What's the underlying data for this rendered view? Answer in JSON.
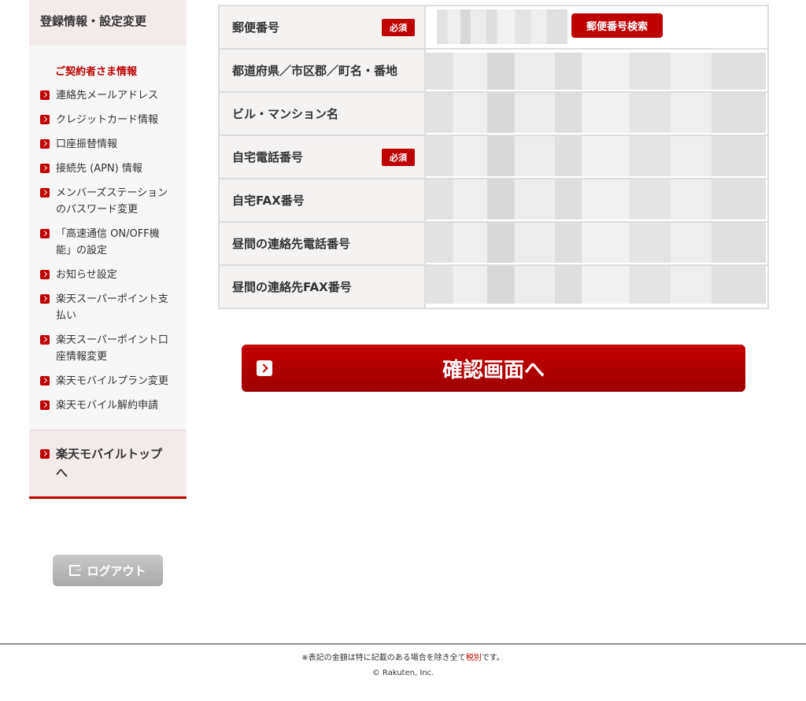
{
  "sidebar": {
    "header": "登録情報・設定変更",
    "section_title": "ご契約者さま情報",
    "items": [
      {
        "label": "連絡先メールアドレス"
      },
      {
        "label": "クレジットカード情報"
      },
      {
        "label": "口座振替情報"
      },
      {
        "label": "接続先 (APN) 情報"
      },
      {
        "label": "メンバーズステーションのパスワード変更"
      },
      {
        "label": "「高速通信 ON/OFF機能」の設定"
      },
      {
        "label": "お知らせ設定"
      },
      {
        "label": "楽天スーパーポイント支払い"
      },
      {
        "label": "楽天スーパーポイント口座情報変更"
      },
      {
        "label": "楽天モバイルプラン変更"
      },
      {
        "label": "楽天モバイル解約申請"
      }
    ],
    "top_link": "楽天モバイルトップへ",
    "logout": "ログアウト"
  },
  "form": {
    "required_badge": "必須",
    "zip_search_button": "郵便番号検索",
    "rows": [
      {
        "label": "郵便番号"
      },
      {
        "label": "都道府県／市区郡／町名・番地"
      },
      {
        "label": "ビル・マンション名"
      },
      {
        "label": "自宅電話番号"
      },
      {
        "label": "自宅FAX番号"
      },
      {
        "label": "昼間の連絡先電話番号"
      },
      {
        "label": "昼間の連絡先FAX番号"
      }
    ]
  },
  "confirm_button": "確認画面へ",
  "footer": {
    "note_prefix": "※表記の金額は特に記載のある場合を除き全て",
    "note_highlight": "税別",
    "note_suffix": "です。",
    "copyright": "© Rakuten, Inc."
  }
}
